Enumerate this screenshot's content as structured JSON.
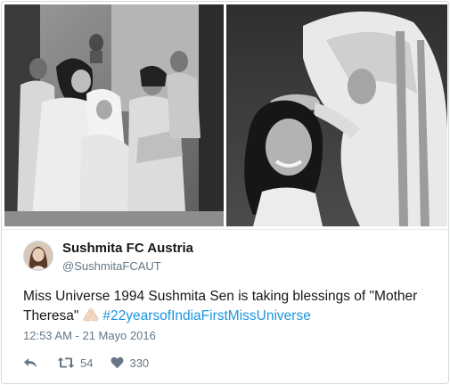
{
  "tweet": {
    "author": {
      "display_name": "Sushmita FC Austria",
      "screen_name": "@SushmitaFCAUT"
    },
    "text_before_emoji": "Miss Universe 1994 Sushmita Sen is taking blessings of \"Mother Theresa\"",
    "emoji": "folded-hands",
    "hashtag": "#22yearsofIndiaFirstMissUniverse",
    "timestamp": "12:53 AM - 21 Mayo 2016",
    "retweet_count": "54",
    "like_count": "330"
  },
  "icons": {
    "reply": "reply-icon",
    "retweet": "retweet-icon",
    "like": "heart-icon"
  },
  "colors": {
    "hashtag": "#1b95e0",
    "secondary_text": "#657786",
    "primary_text": "#14171a"
  }
}
